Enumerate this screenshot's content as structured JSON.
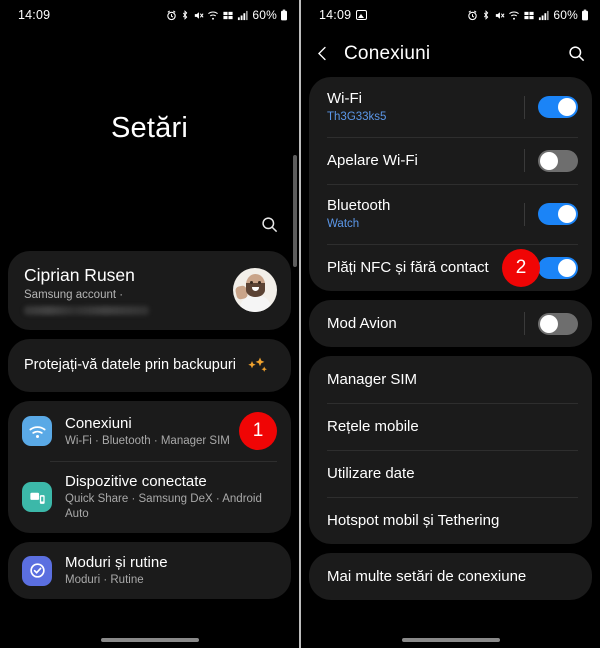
{
  "left": {
    "status": {
      "time": "14:09",
      "battery": "60%",
      "icons": [
        "alarm-icon",
        "bluetooth-icon",
        "mute-icon",
        "wifi-icon",
        "network-icon",
        "signal-icon",
        "battery-icon"
      ]
    },
    "page_title": "Setări",
    "search_icon": "search-icon",
    "account": {
      "name": "Ciprian Rusen",
      "subtitle": "Samsung account  ·",
      "avatar": "user-avatar"
    },
    "backup": {
      "label": "Protejați-vă datele prin backupuri",
      "icon": "sparkles-icon"
    },
    "items": [
      {
        "title": "Conexiuni",
        "subtitle": "Wi-Fi · Bluetooth · Manager SIM",
        "icon": "wifi-settings-icon",
        "icon_color": "#5aa9e6",
        "badge": "1"
      },
      {
        "title": "Dispozitive conectate",
        "subtitle": "Quick Share · Samsung DeX · Android Auto",
        "icon": "connected-devices-icon",
        "icon_color": "#3cb8a9",
        "badge": ""
      },
      {
        "title": "Moduri și rutine",
        "subtitle": "Moduri · Rutine",
        "icon": "modes-routines-icon",
        "icon_color": "#5b6fe0",
        "badge": ""
      }
    ]
  },
  "right": {
    "status": {
      "time": "14:09",
      "battery": "60%",
      "photo_icon": "photo-icon",
      "icons": [
        "alarm-icon",
        "bluetooth-icon",
        "mute-icon",
        "wifi-icon",
        "network-icon",
        "signal-icon",
        "battery-icon"
      ]
    },
    "appbar": {
      "back_icon": "back-chevron-icon",
      "title": "Conexiuni",
      "search_icon": "search-icon"
    },
    "group1": [
      {
        "title": "Wi-Fi",
        "subtitle": "Th3G33ks5",
        "toggle": "on",
        "badge": ""
      },
      {
        "title": "Apelare Wi-Fi",
        "subtitle": "",
        "toggle": "off",
        "badge": ""
      },
      {
        "title": "Bluetooth",
        "subtitle": "Watch",
        "toggle": "on",
        "badge": ""
      },
      {
        "title": "Plăți NFC și fără contact",
        "subtitle": "",
        "toggle": "on",
        "badge": "2"
      }
    ],
    "group2": [
      {
        "title": "Mod Avion",
        "subtitle": "",
        "toggle": "off",
        "badge": ""
      }
    ],
    "group3": [
      {
        "title": "Manager SIM",
        "subtitle": "",
        "toggle": "",
        "badge": ""
      },
      {
        "title": "Rețele mobile",
        "subtitle": "",
        "toggle": "",
        "badge": ""
      },
      {
        "title": "Utilizare date",
        "subtitle": "",
        "toggle": "",
        "badge": ""
      },
      {
        "title": "Hotspot mobil și Tethering",
        "subtitle": "",
        "toggle": "",
        "badge": ""
      }
    ],
    "group4": [
      {
        "title": "Mai multe setări de conexiune",
        "subtitle": "",
        "toggle": "",
        "badge": ""
      }
    ]
  },
  "colors": {
    "badge_red": "#f00505",
    "toggle_on": "#1b84f7",
    "card_bg": "#1b1b1b",
    "link_blue": "#5b97e8"
  }
}
